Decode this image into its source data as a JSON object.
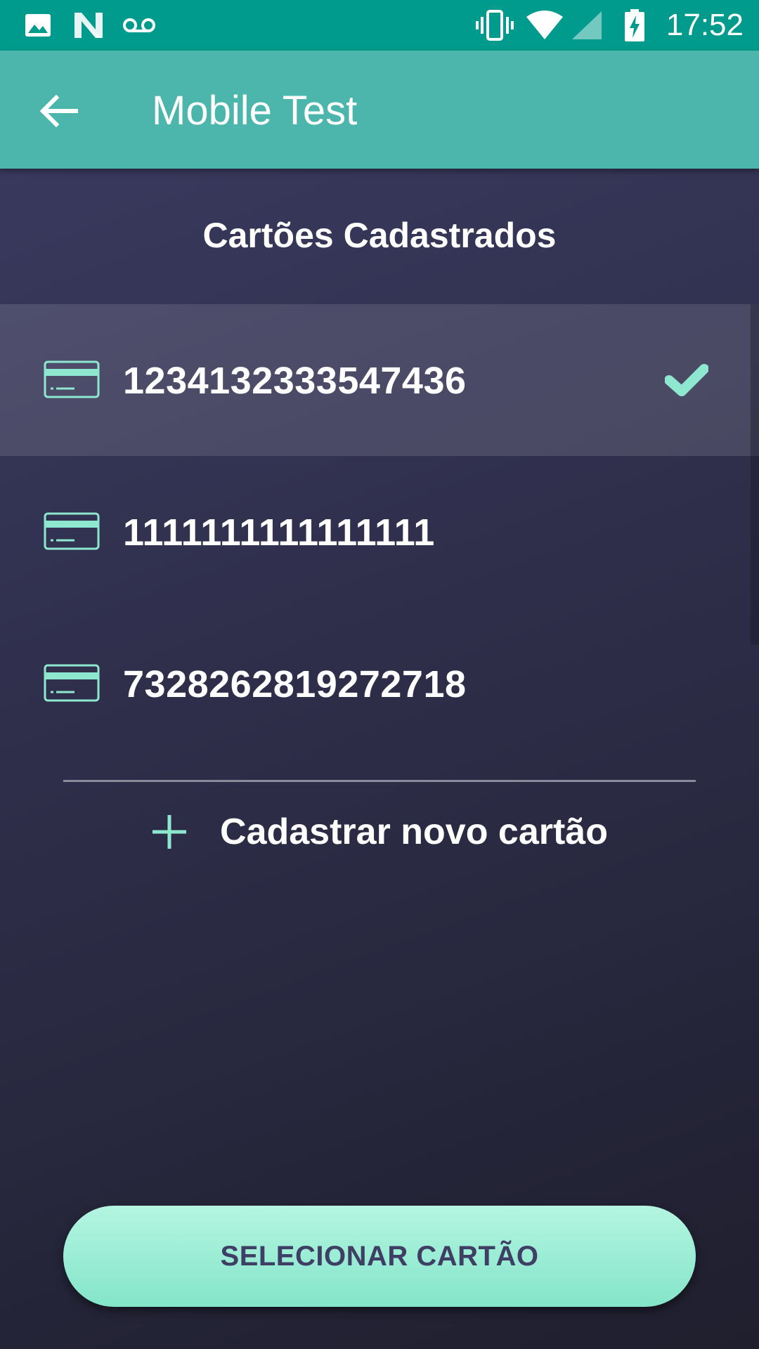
{
  "status_bar": {
    "time": "17:52",
    "left_icons": [
      "image-icon",
      "n-icon",
      "voicemail-icon"
    ],
    "right_icons": [
      "vibrate-icon",
      "wifi-icon",
      "signal-icon",
      "battery-charging-icon"
    ],
    "color": "#009b8c"
  },
  "app_bar": {
    "title": "Mobile Test",
    "back_icon": "arrow-back-icon",
    "color": "#4db6ac"
  },
  "section": {
    "title": "Cartões Cadastrados"
  },
  "cards": [
    {
      "number": "1234132333547436",
      "selected": true
    },
    {
      "number": "1111111111111111",
      "selected": false
    },
    {
      "number": "7328262819272718",
      "selected": false
    }
  ],
  "add_card": {
    "label": "Cadastrar novo cartão",
    "icon": "plus-icon"
  },
  "footer": {
    "select_button_label": "SELECIONAR CARTÃO"
  },
  "colors": {
    "accent": "#8ee8cf",
    "button_text": "#3f3f66",
    "background_top": "#3c3c63",
    "background_bottom": "#1f1f2e"
  }
}
